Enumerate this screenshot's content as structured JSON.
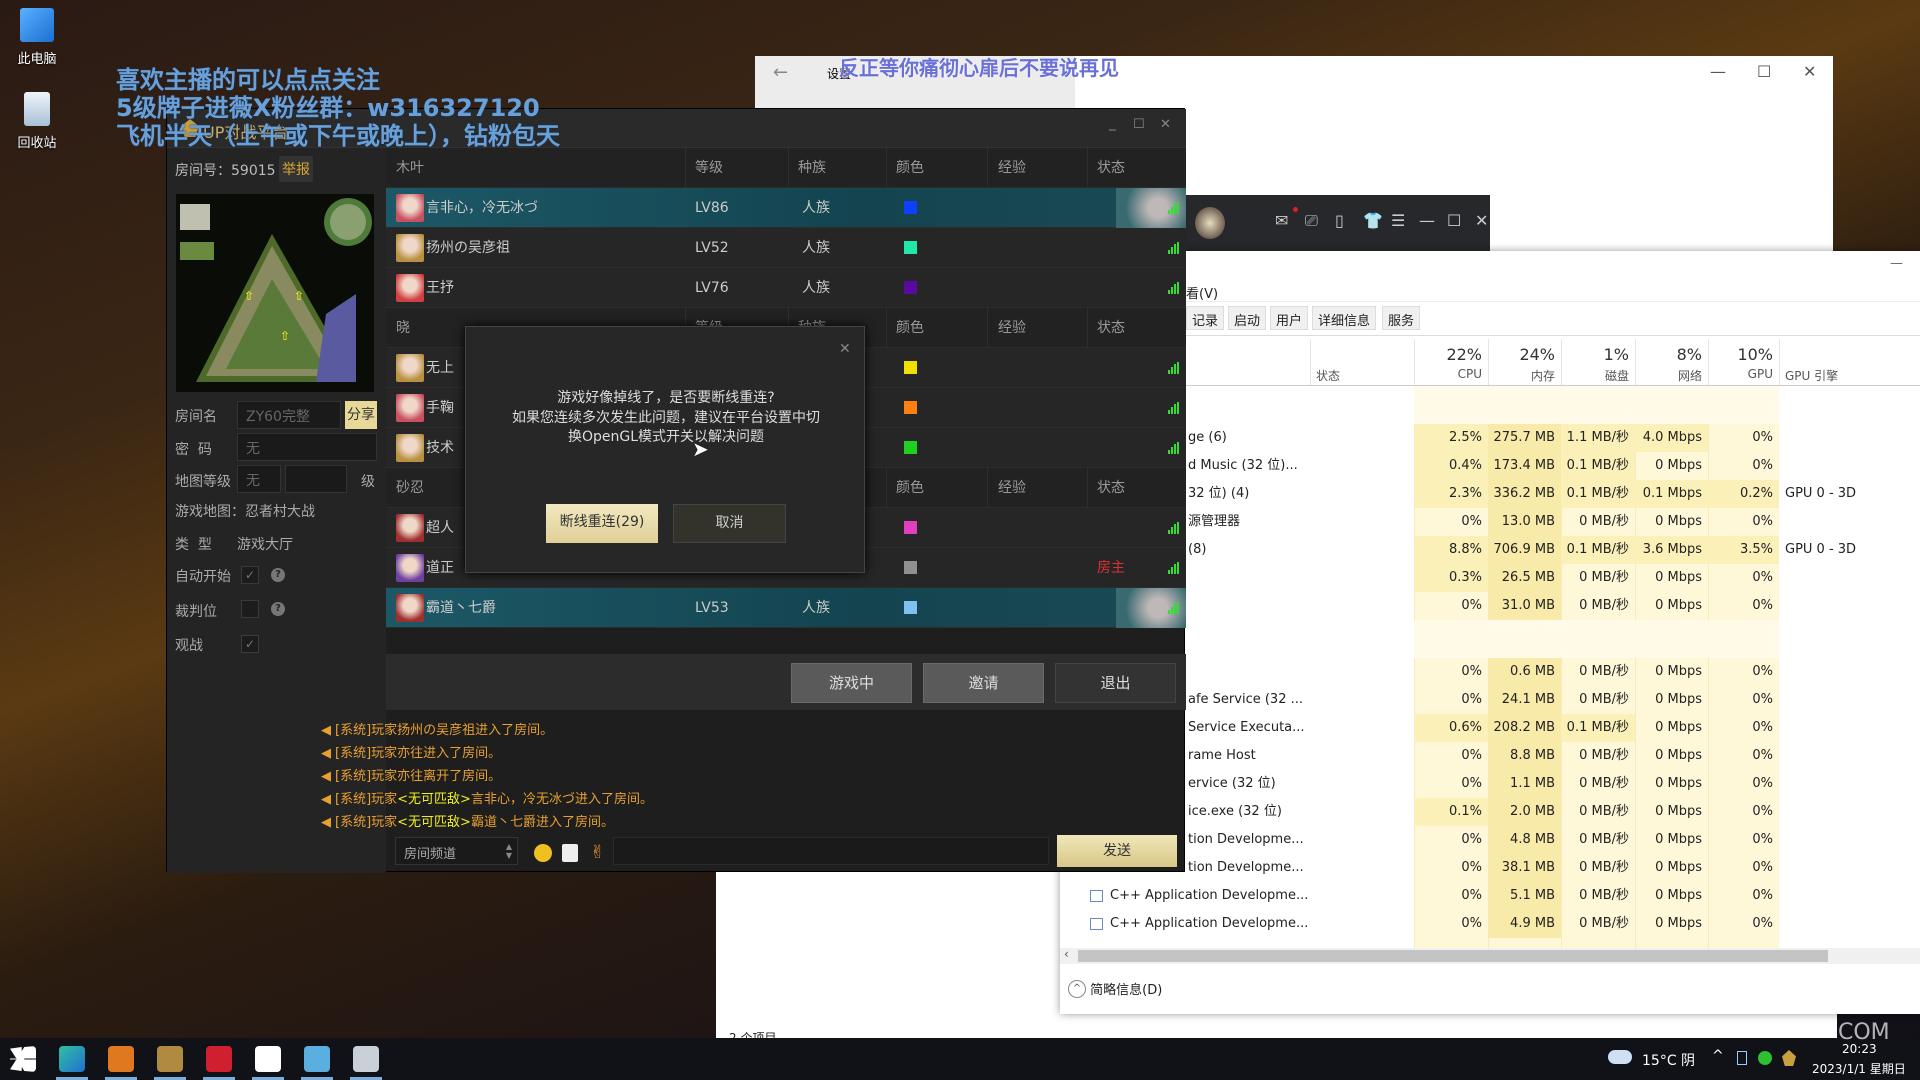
{
  "desktop": {
    "icons": [
      {
        "label": "此电脑",
        "icon": "computer-icon"
      },
      {
        "label": "回收站",
        "icon": "recycle-bin-icon"
      }
    ]
  },
  "overlay": {
    "lines": [
      "喜欢主播的可以点点关注",
      "5级牌子进薇X粉丝群：w316327120",
      "飞机半天（上午或下午或晚上），钻粉包天"
    ],
    "song_lyric": "反正等你痛彻心扉后不要说再见"
  },
  "settings_window": {
    "title": "设置",
    "back": "←",
    "controls": [
      "—",
      "☐",
      "✕"
    ]
  },
  "music_bar": {
    "icons": [
      "mail-icon",
      "screen-icon",
      "mobile-icon",
      "skin-icon",
      "menu-icon",
      "minimize-icon",
      "maximize-icon",
      "close-icon"
    ],
    "glyphs": [
      "✉",
      "⎚",
      "▯",
      "👕",
      "☰",
      "—",
      "☐",
      "✕"
    ]
  },
  "taskmgr": {
    "menu": "看(V)",
    "minimize": "—",
    "tabs": [
      "记录",
      "启动",
      "用户",
      "详细信息",
      "服务"
    ],
    "headers": [
      {
        "pct": "",
        "label": "状态"
      },
      {
        "pct": "22%",
        "label": "CPU"
      },
      {
        "pct": "24%",
        "label": "内存"
      },
      {
        "pct": "1%",
        "label": "磁盘"
      },
      {
        "pct": "8%",
        "label": "网络"
      },
      {
        "pct": "10%",
        "label": "GPU"
      },
      {
        "pct": "",
        "label": "GPU 引擎"
      }
    ],
    "rows": [
      {
        "group": true
      },
      {
        "name": "ge (6)",
        "cpu": "2.5%",
        "mem": "275.7 MB",
        "disk": "1.1 MB/秒",
        "net": "4.0 Mbps",
        "gpu": "0%",
        "engine": ""
      },
      {
        "name": "d Music (32 位)...",
        "cpu": "0.4%",
        "mem": "173.4 MB",
        "disk": "0.1 MB/秒",
        "net": "0 Mbps",
        "gpu": "0%",
        "engine": ""
      },
      {
        "name": "32 位) (4)",
        "cpu": "2.3%",
        "mem": "336.2 MB",
        "disk": "0.1 MB/秒",
        "net": "0.1 Mbps",
        "gpu": "0.2%",
        "engine": "GPU 0 - 3D"
      },
      {
        "name": "源管理器",
        "cpu": "0%",
        "mem": "13.0 MB",
        "disk": "0 MB/秒",
        "net": "0 Mbps",
        "gpu": "0%",
        "engine": ""
      },
      {
        "name": "(8)",
        "cpu": "8.8%",
        "mem": "706.9 MB",
        "disk": "0.1 MB/秒",
        "net": "3.6 Mbps",
        "gpu": "3.5%",
        "engine": "GPU 0 - 3D"
      },
      {
        "name": "",
        "cpu": "0.3%",
        "mem": "26.5 MB",
        "disk": "0 MB/秒",
        "net": "0 Mbps",
        "gpu": "0%",
        "engine": ""
      },
      {
        "name": "",
        "cpu": "0%",
        "mem": "31.0 MB",
        "disk": "0 MB/秒",
        "net": "0 Mbps",
        "gpu": "0%",
        "engine": ""
      },
      {
        "group": true
      },
      {
        "name": "",
        "cpu": "0%",
        "mem": "0.6 MB",
        "disk": "0 MB/秒",
        "net": "0 Mbps",
        "gpu": "0%",
        "engine": ""
      },
      {
        "name": "afe Service (32 ...",
        "cpu": "0%",
        "mem": "24.1 MB",
        "disk": "0 MB/秒",
        "net": "0 Mbps",
        "gpu": "0%",
        "engine": ""
      },
      {
        "name": "Service Executa...",
        "cpu": "0.6%",
        "mem": "208.2 MB",
        "disk": "0.1 MB/秒",
        "net": "0 Mbps",
        "gpu": "0%",
        "engine": ""
      },
      {
        "name": "rame Host",
        "cpu": "0%",
        "mem": "8.8 MB",
        "disk": "0 MB/秒",
        "net": "0 Mbps",
        "gpu": "0%",
        "engine": ""
      },
      {
        "name": "ervice (32 位)",
        "cpu": "0%",
        "mem": "1.1 MB",
        "disk": "0 MB/秒",
        "net": "0 Mbps",
        "gpu": "0%",
        "engine": ""
      },
      {
        "name": "ice.exe (32 位)",
        "cpu": "0.1%",
        "mem": "2.0 MB",
        "disk": "0 MB/秒",
        "net": "0 Mbps",
        "gpu": "0%",
        "engine": ""
      },
      {
        "name": "tion Developme...",
        "cpu": "0%",
        "mem": "4.8 MB",
        "disk": "0 MB/秒",
        "net": "0 Mbps",
        "gpu": "0%",
        "engine": ""
      },
      {
        "name": "tion Developme...",
        "cpu": "0%",
        "mem": "38.1 MB",
        "disk": "0 MB/秒",
        "net": "0 Mbps",
        "gpu": "0%",
        "engine": ""
      },
      {
        "name": "C++ Application Developme...",
        "cpu": "0%",
        "mem": "5.1 MB",
        "disk": "0 MB/秒",
        "net": "0 Mbps",
        "gpu": "0%",
        "engine": "",
        "icon": true
      },
      {
        "name": "C++ Application Developme...",
        "cpu": "0%",
        "mem": "4.9 MB",
        "disk": "0 MB/秒",
        "net": "0 Mbps",
        "gpu": "0%",
        "engine": "",
        "icon": true
      }
    ],
    "fewer_details": "简略信息(D)"
  },
  "explorer": {
    "status": "2 个项目"
  },
  "game": {
    "title": "UP对战平台",
    "controls": [
      "_",
      "☐",
      "✕"
    ],
    "room_label": "房间号：59015",
    "report": "举报",
    "form": {
      "room_name_label": "房间名",
      "room_name_value": "ZY60完整",
      "share": "分享",
      "password_label": "密  码",
      "password_value": "无",
      "map_level_label": "地图等级",
      "map_level_value": "无",
      "map_level_unit": "级",
      "game_map": "游戏地图：忍者村大战",
      "type_label": "类  型",
      "type_value": "游戏大厅",
      "auto_start_label": "自动开始",
      "auto_start_checked": true,
      "referee_label": "裁判位",
      "referee_checked": false,
      "spectate_label": "观战",
      "spectate_checked": true
    },
    "teams": [
      {
        "name": "木叶",
        "headers": [
          "等级",
          "种族",
          "颜色",
          "经验",
          "状态"
        ],
        "players": [
          {
            "name": "言非心，冷无冰づ",
            "level": "LV86",
            "race": "人族",
            "color": "#1040ff",
            "status": "",
            "highlight": true,
            "avatar": "#c85060"
          },
          {
            "name": "扬州の吴彦祖",
            "level": "LV52",
            "race": "人族",
            "color": "#20e8a8",
            "status": "",
            "highlight": false,
            "avatar": "#b89040"
          },
          {
            "name": "王抒",
            "level": "LV76",
            "race": "人族",
            "color": "#5a0aa0",
            "status": "",
            "highlight": false,
            "avatar": "#d04040"
          }
        ]
      },
      {
        "name": "晓",
        "headers": [
          "等级",
          "种族",
          "颜色",
          "经验",
          "状态"
        ],
        "players": [
          {
            "name": "无上",
            "level": "",
            "race": "",
            "color": "#f0e000",
            "status": "",
            "highlight": false,
            "avatar": "#b89040"
          },
          {
            "name": "手鞠",
            "level": "",
            "race": "",
            "color": "#ff8010",
            "status": "",
            "highlight": false,
            "avatar": "#c85060"
          },
          {
            "name": "技术",
            "level": "",
            "race": "",
            "color": "#20d020",
            "status": "",
            "highlight": false,
            "avatar": "#b89040"
          }
        ]
      },
      {
        "name": "砂忍",
        "headers": [
          "等级",
          "种族",
          "颜色",
          "经验",
          "状态"
        ],
        "players": [
          {
            "name": "超人",
            "level": "",
            "race": "",
            "color": "#e040c0",
            "status": "",
            "highlight": false,
            "avatar": "#a03030"
          },
          {
            "name": "道正",
            "level": "",
            "race": "",
            "color": "#909090",
            "status": "房主",
            "highlight": false,
            "avatar": "#7040a0"
          },
          {
            "name": "霸道丶七爵",
            "level": "LV53",
            "race": "人族",
            "color": "#80c0f0",
            "status": "",
            "highlight": true,
            "avatar": "#a03030"
          }
        ]
      }
    ],
    "buttons": {
      "in_game": "游戏中",
      "invite": "邀请",
      "exit": "退出"
    },
    "chat": [
      {
        "a": "[系统]玩家扬州の吴彦祖进入了房间。",
        "b": "",
        "c": ""
      },
      {
        "a": "[系统]玩家亦往进入了房间。",
        "b": "",
        "c": ""
      },
      {
        "a": "[系统]玩家亦往离开了房间。",
        "b": "",
        "c": ""
      },
      {
        "a": "[系统]玩家",
        "b": "<无可匹敌>",
        "c": "言非心，冷无冰づ进入了房间。"
      },
      {
        "a": "[系统]玩家",
        "b": "<无可匹敌>",
        "c": "霸道丶七爵进入了房间。"
      }
    ],
    "channel": "房间频道",
    "send": "发送",
    "status_colors": {
      "host": "#e03030",
      "signal": "#30e030"
    }
  },
  "dialog": {
    "close": "✕",
    "lines": [
      "游戏好像掉线了，是否要断线重连?",
      "如果您连续多次发生此问题，建议在平台设置中切",
      "换OpenGL模式开关以解决问题"
    ],
    "reconnect": "断线重连(29)",
    "cancel": "取消"
  },
  "taskbar": {
    "apps": [
      "start-icon",
      "edge-icon",
      "help-app-icon",
      "game-platform-icon",
      "netease-music-icon",
      "settings-icon",
      "control-panel-icon",
      "explorer-icon"
    ],
    "weather": "15°C 阴",
    "time": "20:23",
    "date": "2023/1/1 星期日",
    "watermark": "COM"
  }
}
